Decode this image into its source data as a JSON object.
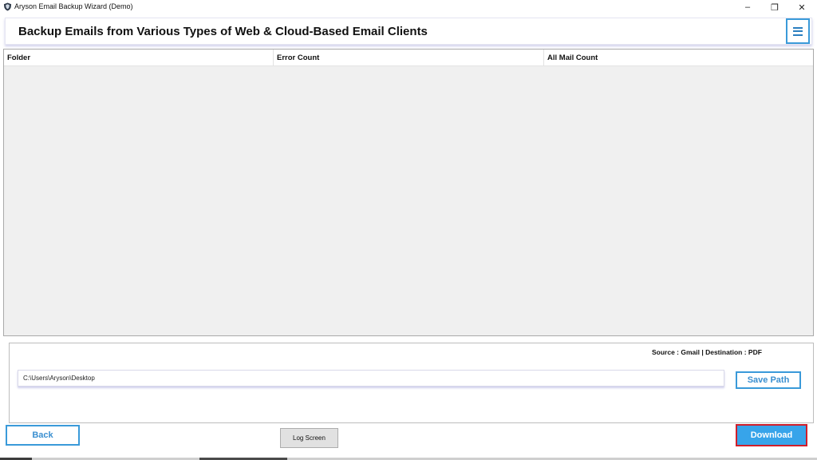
{
  "window": {
    "title": "Aryson Email Backup Wizard (Demo)",
    "controls": {
      "minimize": "–",
      "maximize": "❐",
      "close": "✕"
    }
  },
  "header": {
    "title": "Backup Emails from Various Types of Web & Cloud-Based Email Clients",
    "menu_icon": "hamburger-menu-icon"
  },
  "table": {
    "columns": [
      "Folder",
      "Error Count",
      "All Mail Count"
    ],
    "rows": []
  },
  "destination": {
    "summary": "Source : Gmail | Destination : PDF",
    "path_value": "C:\\Users\\Aryson\\Desktop",
    "save_path_label": "Save Path"
  },
  "footer": {
    "back_label": "Back",
    "log_screen_label": "Log Screen",
    "download_label": "Download"
  },
  "colors": {
    "accent": "#3a9ad9",
    "download_fill": "#37a4ea",
    "download_border": "#d01e2a",
    "grid_background": "#f0f0f0"
  }
}
